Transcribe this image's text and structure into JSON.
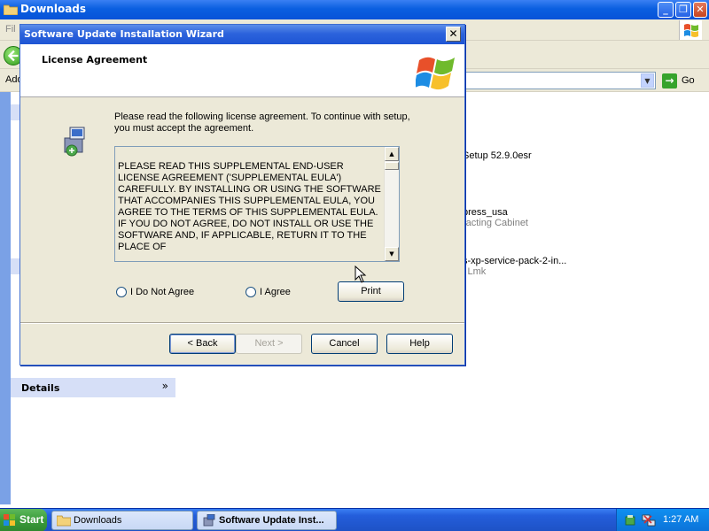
{
  "explorer": {
    "title": "Downloads",
    "menu_partial": "Fil",
    "address_label": "Add",
    "go_label": "Go",
    "details_label": "Details",
    "files": [
      {
        "name": "Setup 52.9.0esr",
        "sub": ""
      },
      {
        "name": "press_usa",
        "sub": "racting Cabinet"
      },
      {
        "name": "s-xp-service-pack-2-in...",
        "sub": "l Lmk"
      }
    ]
  },
  "dialog": {
    "title": "Software Update Installation Wizard",
    "close_label": "✕",
    "header_title": "License Agreement",
    "intro": "Please read the following license agreement. To continue with setup, you must accept the agreement.",
    "eula_text": "PLEASE READ THIS SUPPLEMENTAL END-USER LICENSE AGREEMENT ('SUPPLEMENTAL EULA') CAREFULLY. BY INSTALLING OR USING THE SOFTWARE THAT ACCOMPANIES THIS SUPPLEMENTAL EULA, YOU AGREE TO THE TERMS OF THIS SUPPLEMENTAL EULA. IF YOU DO NOT AGREE, DO NOT INSTALL OR USE THE SOFTWARE AND, IF APPLICABLE, RETURN IT TO THE PLACE OF",
    "radio_disagree": "I Do Not Agree",
    "radio_agree": "I Agree",
    "print_label": "Print",
    "back_label": "< Back",
    "next_label": "Next >",
    "cancel_label": "Cancel",
    "help_label": "Help"
  },
  "taskbar": {
    "start_label": "Start",
    "tasks": [
      {
        "label": "Downloads",
        "icon": "folder-icon"
      },
      {
        "label": "Software Update Inst...",
        "icon": "setup-icon"
      }
    ],
    "clock": "1:27 AM"
  },
  "icons": [
    "folder-icon",
    "minimize-icon",
    "restore-icon",
    "close-icon",
    "windows-flag-icon",
    "back-icon",
    "dropdown-icon",
    "go-icon",
    "chevron-down-icon",
    "setup-icon",
    "scroll-up-icon",
    "scroll-down-icon",
    "cursor-icon",
    "network-icon",
    "safely-remove-icon"
  ],
  "colors": {
    "accent": "#0a5fe0",
    "dialog_bg": "#ece9d8",
    "taskbar": "#245edb"
  }
}
